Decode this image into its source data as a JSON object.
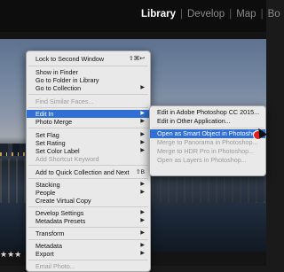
{
  "module_nav": {
    "items": [
      {
        "label": "Library",
        "active": true
      },
      {
        "label": "Develop",
        "active": false
      },
      {
        "label": "Map",
        "active": false
      },
      {
        "label": "Bo",
        "active": false
      }
    ],
    "separator": "|"
  },
  "rating": "★★★",
  "context_menu": {
    "items": [
      {
        "label": "Lock to Second Window",
        "shortcut": "⇧⌘↩",
        "arrow": false,
        "disabled": false,
        "highlighted": false
      },
      {
        "label": "Show in Finder",
        "shortcut": "",
        "arrow": false,
        "disabled": false,
        "highlighted": false
      },
      {
        "label": "Go to Folder in Library",
        "shortcut": "",
        "arrow": false,
        "disabled": false,
        "highlighted": false
      },
      {
        "label": "Go to Collection",
        "shortcut": "",
        "arrow": true,
        "disabled": false,
        "highlighted": false
      },
      {
        "label": "Find Similar Faces...",
        "shortcut": "",
        "arrow": false,
        "disabled": true,
        "highlighted": false
      },
      {
        "label": "Edit In",
        "shortcut": "",
        "arrow": true,
        "disabled": false,
        "highlighted": true
      },
      {
        "label": "Photo Merge",
        "shortcut": "",
        "arrow": true,
        "disabled": false,
        "highlighted": false
      },
      {
        "label": "Set Flag",
        "shortcut": "",
        "arrow": true,
        "disabled": false,
        "highlighted": false
      },
      {
        "label": "Set Rating",
        "shortcut": "",
        "arrow": true,
        "disabled": false,
        "highlighted": false
      },
      {
        "label": "Set Color Label",
        "shortcut": "",
        "arrow": true,
        "disabled": false,
        "highlighted": false
      },
      {
        "label": "Add Shortcut Keyword",
        "shortcut": "",
        "arrow": false,
        "disabled": true,
        "highlighted": false
      },
      {
        "label": "Add to Quick Collection and Next",
        "shortcut": "⇧B",
        "arrow": false,
        "disabled": false,
        "highlighted": false
      },
      {
        "label": "Stacking",
        "shortcut": "",
        "arrow": true,
        "disabled": false,
        "highlighted": false
      },
      {
        "label": "People",
        "shortcut": "",
        "arrow": true,
        "disabled": false,
        "highlighted": false
      },
      {
        "label": "Create Virtual Copy",
        "shortcut": "",
        "arrow": false,
        "disabled": false,
        "highlighted": false
      },
      {
        "label": "Develop Settings",
        "shortcut": "",
        "arrow": true,
        "disabled": false,
        "highlighted": false
      },
      {
        "label": "Metadata Presets",
        "shortcut": "",
        "arrow": true,
        "disabled": false,
        "highlighted": false
      },
      {
        "label": "Transform",
        "shortcut": "",
        "arrow": true,
        "disabled": false,
        "highlighted": false
      },
      {
        "label": "Metadata",
        "shortcut": "",
        "arrow": true,
        "disabled": false,
        "highlighted": false
      },
      {
        "label": "Export",
        "shortcut": "",
        "arrow": true,
        "disabled": false,
        "highlighted": false
      },
      {
        "label": "Email Photo...",
        "shortcut": "",
        "arrow": false,
        "disabled": true,
        "highlighted": false
      }
    ]
  },
  "submenu": {
    "items": [
      {
        "label": "Edit in Adobe Photoshop CC 2015...",
        "disabled": false,
        "highlighted": false
      },
      {
        "label": "Edit in Other Application...",
        "disabled": false,
        "highlighted": false
      },
      {
        "label": "Open as Smart Object in Photoshop...",
        "disabled": false,
        "highlighted": true
      },
      {
        "label": "Merge to Panorama in Photoshop...",
        "disabled": true,
        "highlighted": false
      },
      {
        "label": "Merge to HDR Pro in Photoshop...",
        "disabled": true,
        "highlighted": false
      },
      {
        "label": "Open as Layers in Photoshop...",
        "disabled": true,
        "highlighted": false
      }
    ]
  },
  "colors": {
    "highlight": "#2f6fd6",
    "menu_bg": "#e9e9e9",
    "disabled_text": "#9b9b9b",
    "topbar_bg": "#0d0d0d"
  },
  "icons": [
    "submenu-arrow-icon",
    "mouse-cursor-icon",
    "red-marker-icon",
    "star-icon"
  ]
}
